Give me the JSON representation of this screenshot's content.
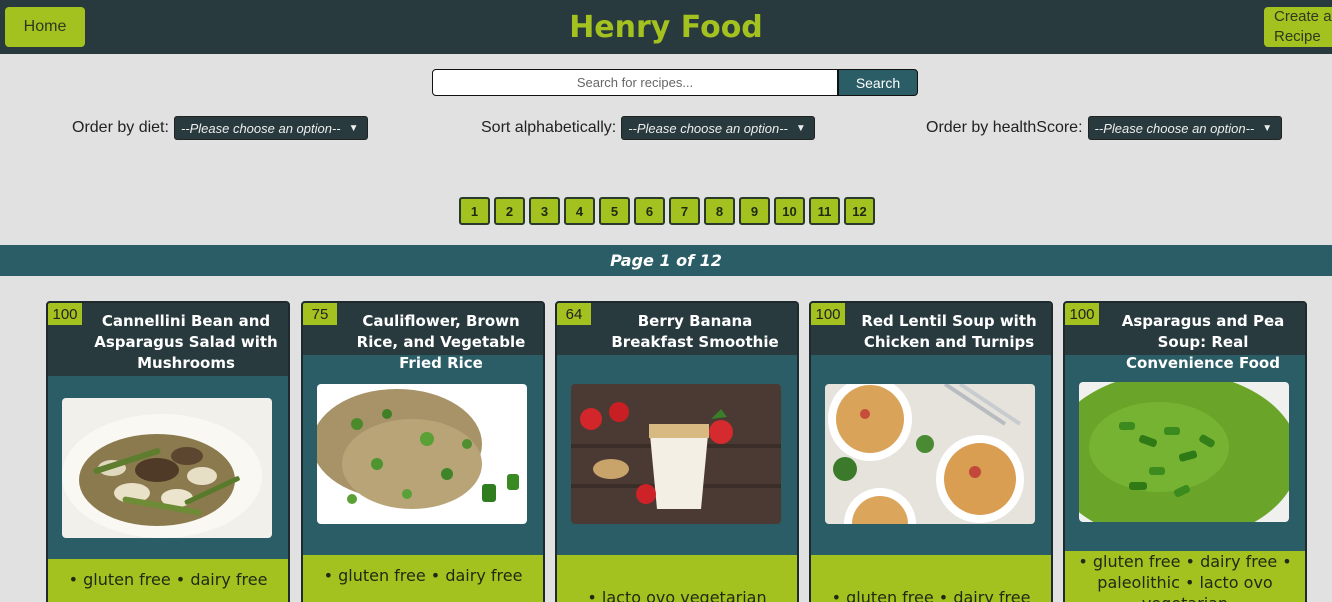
{
  "header": {
    "home_label": "Home",
    "brand": "Henry Food",
    "create_label": "Create a Recipe",
    "brand_color": "#a3c11f",
    "bar_color": "#283a3e"
  },
  "search": {
    "placeholder": "Search for recipes...",
    "button_label": "Search"
  },
  "filters": {
    "diet": {
      "label": "Order by diet:",
      "selected": "--Please choose an option--"
    },
    "alpha": {
      "label": "Sort alphabetically:",
      "selected": "--Please choose an option--"
    },
    "health": {
      "label": "Order by healthScore:",
      "selected": "--Please choose an option--"
    }
  },
  "pagination": {
    "pages": [
      "1",
      "2",
      "3",
      "4",
      "5",
      "6",
      "7",
      "8",
      "9",
      "10",
      "11",
      "12"
    ],
    "status": "Page 1 of 12"
  },
  "recipes": [
    {
      "score": "100",
      "title": "Cannellini Bean and Asparagus Salad with Mushrooms",
      "diets": "• gluten free   • dairy free"
    },
    {
      "score": "75",
      "title": "Cauliflower, Brown Rice, and Vegetable Fried Rice",
      "diets": "• gluten free   • dairy free"
    },
    {
      "score": "64",
      "title": "Berry Banana Breakfast Smoothie",
      "diets": "• lacto ovo vegetarian"
    },
    {
      "score": "100",
      "title": "Red Lentil Soup with Chicken and Turnips",
      "diets": "• gluten free   • dairy free"
    },
    {
      "score": "100",
      "title": "Asparagus and Pea Soup: Real Convenience Food",
      "diets": "• gluten free   • dairy free   • paleolithic   • lacto ovo vegetarian"
    }
  ]
}
